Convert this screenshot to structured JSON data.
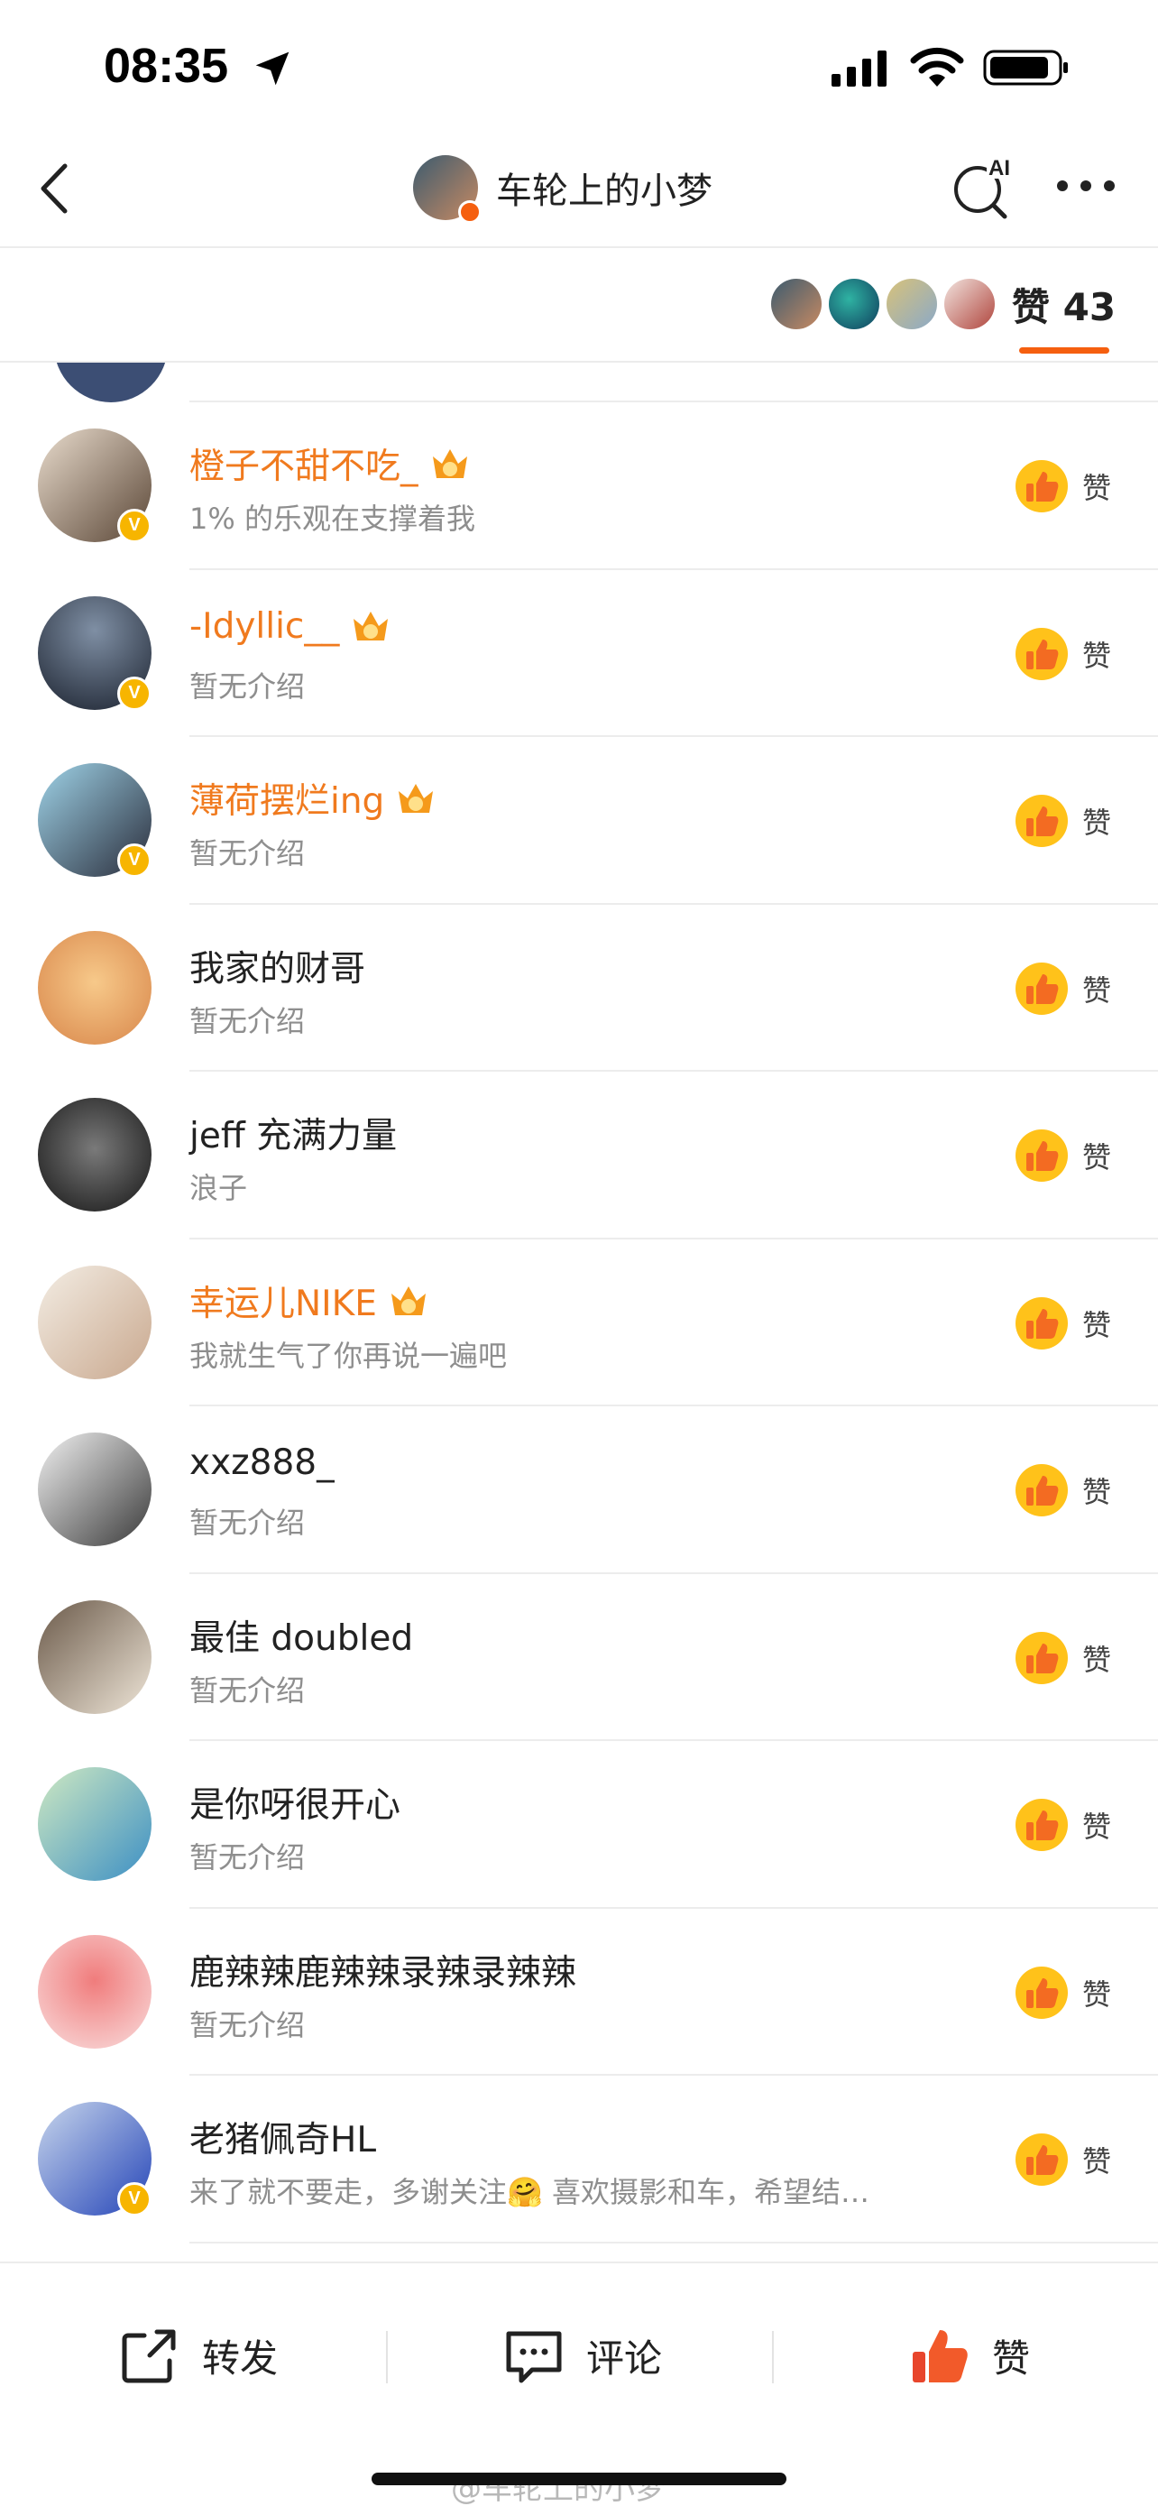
{
  "status_bar": {
    "time": "08:35"
  },
  "nav": {
    "title": "车轮上的小梦",
    "ai_label": "AI"
  },
  "likes_header": {
    "tab_label": "赞 43"
  },
  "colors": {
    "accent": "#f55f0f",
    "vip_name": "#f07a1e",
    "bio": "#8e8e8e",
    "verified": "#f7b500"
  },
  "like_button_label": "赞",
  "rows": [
    {
      "name": "橙子不甜不吃_",
      "bio": "1% 的乐观在支撑着我",
      "vip": true,
      "crown_level": "5",
      "verified": true
    },
    {
      "name": "-Idyllic__",
      "bio": "暂无介绍",
      "vip": true,
      "crown_level": "5",
      "verified": true
    },
    {
      "name": "薄荷摆烂ing",
      "bio": "暂无介绍",
      "vip": true,
      "crown_level": "7",
      "verified": true
    },
    {
      "name": "我家的财哥",
      "bio": "暂无介绍",
      "vip": false,
      "verified": false
    },
    {
      "name": "jeff 充满力量",
      "bio": "浪子",
      "vip": false,
      "verified": false
    },
    {
      "name": "幸运儿NIKE",
      "bio": "我就生气了你再说一遍吧",
      "vip": true,
      "crown_level": "6",
      "verified": false
    },
    {
      "name": "xxz888_",
      "bio": "暂无介绍",
      "vip": false,
      "verified": false
    },
    {
      "name": "最佳 doubled",
      "bio": "暂无介绍",
      "vip": false,
      "verified": false
    },
    {
      "name": "是你呀很开心",
      "bio": "暂无介绍",
      "vip": false,
      "verified": false
    },
    {
      "name": "鹿辣辣鹿辣辣录辣录辣辣",
      "bio": "暂无介绍",
      "vip": false,
      "verified": false
    },
    {
      "name": "老猪佩奇HL",
      "bio": "来了就不要走，多谢关注🤗 喜欢摄影和车，希望结…",
      "vip": false,
      "verified": true
    }
  ],
  "bottom_bar": {
    "repost": "转发",
    "comment": "评论",
    "like": "赞",
    "watermark": "@车轮上的小梦"
  }
}
